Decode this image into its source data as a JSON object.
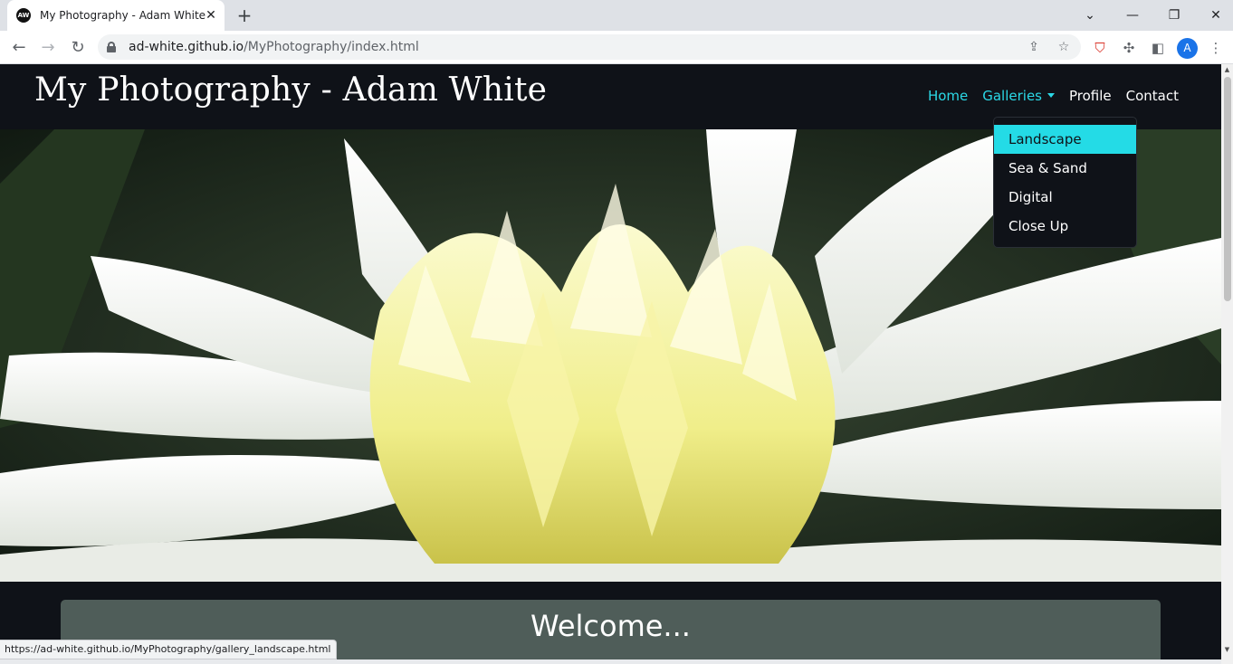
{
  "browser": {
    "tab_title": "My Photography - Adam White",
    "favicon_text": "AW",
    "tab_close": "✕",
    "new_tab": "+",
    "url_host": "ad-white.github.io",
    "url_path": "/MyPhotography/index.html",
    "profile_initial": "A",
    "status_url": "https://ad-white.github.io/MyPhotography/gallery_landscape.html"
  },
  "site": {
    "brand": "My Photography - Adam White",
    "nav": {
      "home": "Home",
      "galleries": "Galleries",
      "profile": "Profile",
      "contact": "Contact"
    },
    "galleries_menu": [
      "Landscape",
      "Sea & Sand",
      "Digital",
      "Close Up"
    ],
    "welcome": "Welcome..."
  },
  "colors": {
    "page_bg": "#0f1218",
    "accent": "#2bd8e6",
    "dropdown_hover": "#24dbe6",
    "card_bg": "#4f5d59"
  },
  "icons": {
    "hero_image": "white-dahlia-photo"
  }
}
